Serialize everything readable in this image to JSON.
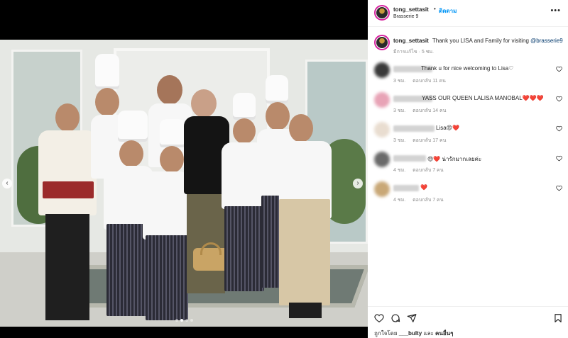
{
  "post": {
    "username": "tong_settasit",
    "separator": "•",
    "follow_label": "ติดตาม",
    "location": "Brasserie 9",
    "more_label": "•••"
  },
  "caption": {
    "username": "tong_settasit",
    "text": "Thank you LISA and Family for visiting",
    "mention": "@brasserie9",
    "time": "มีการแก้ไข · 5 ชม."
  },
  "comments": [
    {
      "text": "Thank u for nice welcoming to Lisa♡",
      "time": "3 ชม.",
      "reply": "ตอบกลับ 11 คน",
      "avatar_color": "#3a3a3a"
    },
    {
      "text": "YASS OUR QUEEN LALISA MANOBAL❤️❤️❤️",
      "time": "3 ชม.",
      "reply": "ตอบกลับ 14 คน",
      "avatar_color": "#e8a3b6"
    },
    {
      "text": "Lisa😍❤️",
      "time": "3 ชม.",
      "reply": "ตอบกลับ 17 คน",
      "avatar_color": "#e9ddd0"
    },
    {
      "text": "😍❤️ น่ารักมากเลยค่ะ",
      "time": "4 ชม.",
      "reply": "ตอบกลับ 7 คน",
      "avatar_color": "#6a6a6a"
    },
    {
      "text": "❤️",
      "time": "4 ชม.",
      "reply": "ตอบกลับ 7 คน",
      "avatar_color": "#c9a877"
    }
  ],
  "likes": {
    "prefix": "ถูกใจโดย",
    "user": "___bulty",
    "suffix": "และ",
    "others": "คนอื่นๆ"
  },
  "carousel": {
    "current": 2,
    "total": 4
  },
  "colors": {
    "accent": "#0095f6",
    "mention": "#00376b",
    "muted": "#8e8e8e",
    "heart": "#ed4956"
  },
  "icons": [
    "heart-icon",
    "comment-icon",
    "share-icon",
    "bookmark-icon",
    "chevron-left-icon",
    "chevron-right-icon",
    "more-icon"
  ]
}
